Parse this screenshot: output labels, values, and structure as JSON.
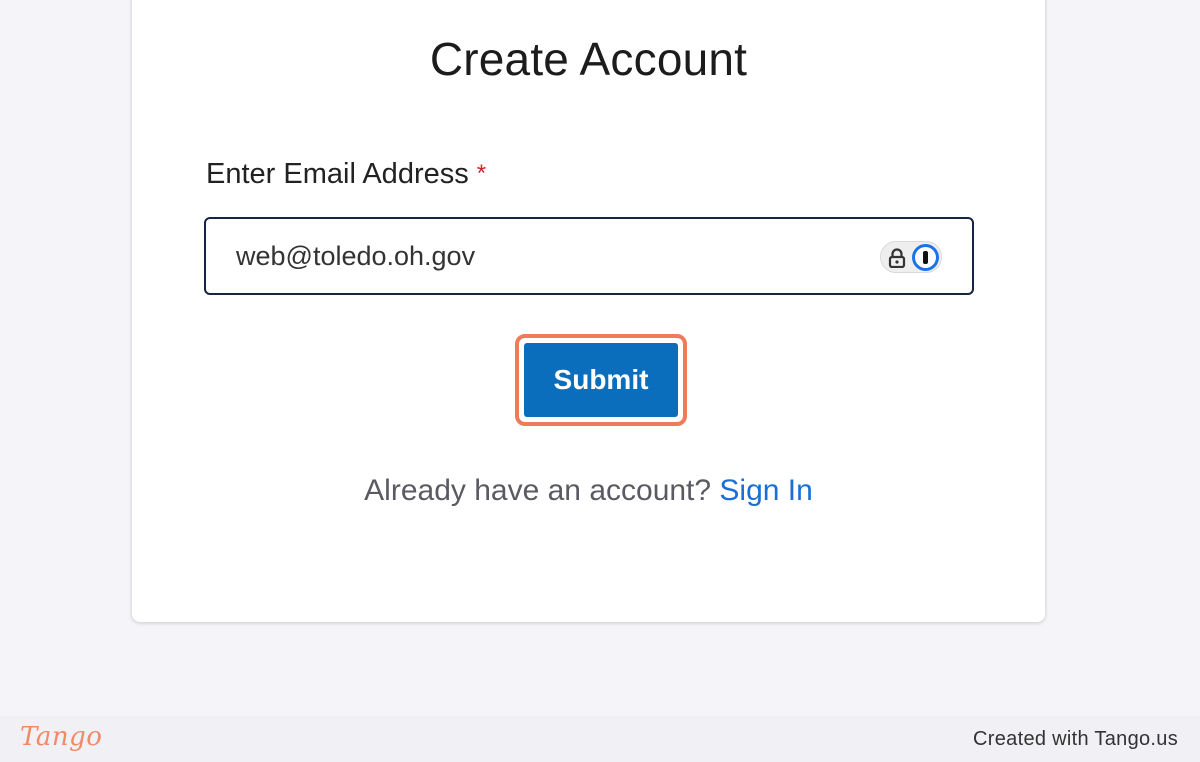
{
  "form": {
    "title": "Create Account",
    "email_label": "Enter Email Address",
    "required_marker": "*",
    "email_value": "web@toledo.oh.gov",
    "submit_label": "Submit",
    "signin_prompt": "Already have an account?",
    "signin_link": "Sign In"
  },
  "password_manager": {
    "icons": [
      "lock-icon",
      "1password-icon"
    ]
  },
  "footer": {
    "logo_text": "Tango",
    "credit_text": "Created with Tango.us"
  },
  "colors": {
    "primary_button": "#0a6ebd",
    "highlight_ring": "#f07b5a",
    "link": "#1a6fd6",
    "required": "#d21f2b",
    "input_border": "#152440"
  }
}
